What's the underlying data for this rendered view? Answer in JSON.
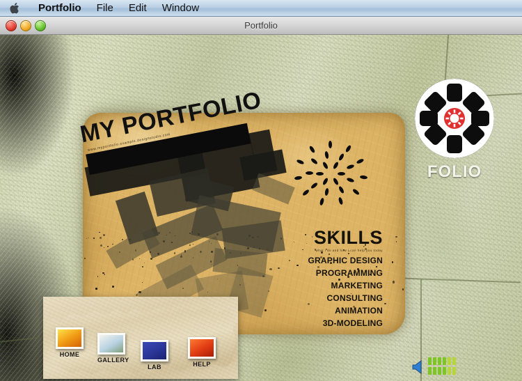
{
  "menubar": {
    "apple_icon": "apple-logo-icon",
    "items": [
      {
        "label": "Portfolio",
        "bold": true
      },
      {
        "label": "File",
        "bold": false
      },
      {
        "label": "Edit",
        "bold": false
      },
      {
        "label": "Window",
        "bold": false
      }
    ]
  },
  "window": {
    "title": "Portfolio",
    "controls": [
      {
        "name": "close-button",
        "color": "#e23c2d"
      },
      {
        "name": "minimize-button",
        "color": "#f0a824"
      },
      {
        "name": "zoom-button",
        "color": "#62c02c"
      }
    ]
  },
  "hero": {
    "title": "MY PORTFOLIO",
    "subtitle": "www.myportfolio.example.designstudio.com"
  },
  "logo": {
    "label": "FOLIO",
    "disc_color": "#ffffff",
    "hub_color": "#e03030"
  },
  "skills": {
    "heading": "SKILLS",
    "subheading": "what i do and how i can help you today",
    "items": [
      "GRAPHIC DESIGN",
      "PROGRAMMING",
      "MARKETING",
      "CONSULTING",
      "ANIMATION",
      "3D-MODELING"
    ]
  },
  "nav": {
    "items": [
      {
        "label": "HOME",
        "swatch_top": "#ffe24a",
        "swatch_mid": "#f09a14",
        "swatch_bot": "#d2620a"
      },
      {
        "label": "GALLERY",
        "swatch_top": "#f2f4ee",
        "swatch_mid": "#b9d2e2",
        "swatch_bot": "#7f9e7a"
      },
      {
        "label": "LAB",
        "swatch_top": "#3b49b8",
        "swatch_mid": "#2a3596",
        "swatch_bot": "#1b2370"
      },
      {
        "label": "HELP",
        "swatch_top": "#ff7a33",
        "swatch_mid": "#e03a12",
        "swatch_bot": "#a81c08"
      }
    ]
  },
  "volume": {
    "icon": "speaker-icon",
    "icon_color": "#2f7fd0",
    "bar_color": "#7ec624",
    "bar_color_alt": "#b6d63a",
    "rows": 2,
    "bars_per_row": 6,
    "level": 12
  },
  "colors": {
    "parchment": "#ddb466",
    "wall": "#c9cdaa",
    "ink": "#111111"
  }
}
